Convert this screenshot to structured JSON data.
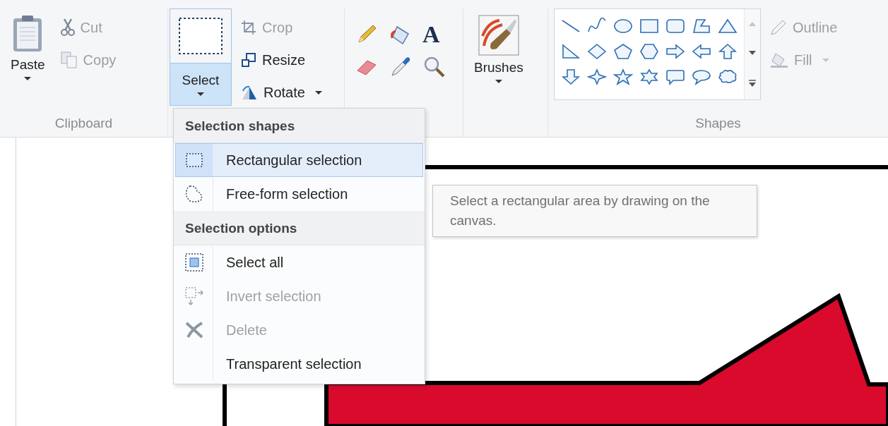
{
  "clipboard": {
    "paste": "Paste",
    "cut": {
      "label": "Cut",
      "disabled": true
    },
    "copy": {
      "label": "Copy",
      "disabled": true
    },
    "label": "Clipboard"
  },
  "image": {
    "select": {
      "label": "Select",
      "open": true
    },
    "crop": {
      "label": "Crop",
      "disabled": true
    },
    "resize": {
      "label": "Resize",
      "disabled": false
    },
    "rotate": {
      "label": "Rotate",
      "disabled": false
    }
  },
  "tools": {
    "text_glyph": "A"
  },
  "brushes": {
    "label": "Brushes"
  },
  "shapes": {
    "label": "Shapes",
    "outline": {
      "label": "Outline",
      "disabled": true
    },
    "fill": {
      "label": "Fill",
      "disabled": true
    }
  },
  "select_menu": {
    "sections": [
      {
        "heading": "Selection shapes",
        "items": [
          {
            "kind": "rect",
            "label": "Rectangular selection",
            "highlighted": true,
            "disabled": false
          },
          {
            "kind": "freeform",
            "label": "Free-form selection",
            "highlighted": false,
            "disabled": false
          }
        ]
      },
      {
        "heading": "Selection options",
        "items": [
          {
            "kind": "all",
            "label": "Select all",
            "highlighted": false,
            "disabled": false
          },
          {
            "kind": "invert",
            "label": "Invert selection",
            "highlighted": false,
            "disabled": true
          },
          {
            "kind": "delete",
            "label": "Delete",
            "highlighted": false,
            "disabled": true
          },
          {
            "kind": "none",
            "label": "Transparent selection",
            "highlighted": false,
            "disabled": false
          }
        ]
      }
    ]
  },
  "tooltip": "Select a rectangular area by drawing on the canvas."
}
